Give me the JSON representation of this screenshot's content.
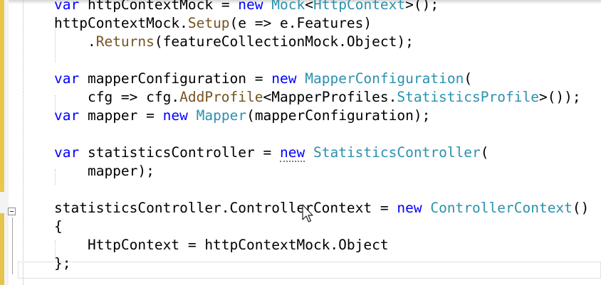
{
  "editor": {
    "lines": [
      [
        {
          "t": "var",
          "c": "kw"
        },
        {
          "t": " httpContextMock = "
        },
        {
          "t": "new",
          "c": "kw"
        },
        {
          "t": " "
        },
        {
          "t": "Mock",
          "c": "ty"
        },
        {
          "t": "<"
        },
        {
          "t": "HttpContext",
          "c": "ty"
        },
        {
          "t": ">();"
        }
      ],
      [
        {
          "t": "httpContextMock."
        },
        {
          "t": "Setup",
          "c": "me"
        },
        {
          "t": "(e => e.Features)"
        }
      ],
      [
        {
          "t": "    ."
        },
        {
          "t": "Returns",
          "c": "me"
        },
        {
          "t": "(featureCollectionMock.Object);"
        }
      ],
      [],
      [
        {
          "t": "var",
          "c": "kw"
        },
        {
          "t": " mapperConfiguration = "
        },
        {
          "t": "new",
          "c": "kw"
        },
        {
          "t": " "
        },
        {
          "t": "MapperConfiguration",
          "c": "ty"
        },
        {
          "t": "("
        }
      ],
      [
        {
          "t": "    cfg => cfg."
        },
        {
          "t": "AddProfile",
          "c": "me"
        },
        {
          "t": "<MapperProfiles."
        },
        {
          "t": "StatisticsProfile",
          "c": "ty"
        },
        {
          "t": ">());"
        }
      ],
      [
        {
          "t": "var",
          "c": "kw"
        },
        {
          "t": " mapper = "
        },
        {
          "t": "new",
          "c": "kw"
        },
        {
          "t": " "
        },
        {
          "t": "Mapper",
          "c": "ty"
        },
        {
          "t": "(mapperConfiguration);"
        }
      ],
      [],
      [
        {
          "t": "var",
          "c": "kw"
        },
        {
          "t": " statisticsController = "
        },
        {
          "t": "new",
          "c": "kw sq"
        },
        {
          "t": " "
        },
        {
          "t": "StatisticsController",
          "c": "ty"
        },
        {
          "t": "("
        }
      ],
      [
        {
          "t": "    mapper);"
        }
      ],
      [],
      [
        {
          "t": "statisticsController.ControllerContext = "
        },
        {
          "t": "new",
          "c": "kw"
        },
        {
          "t": " "
        },
        {
          "t": "ControllerContext",
          "c": "ty"
        },
        {
          "t": "()"
        }
      ],
      [
        {
          "t": "{"
        }
      ],
      [
        {
          "t": "    HttpContext = httpContextMock.Object"
        }
      ],
      [
        {
          "t": "};"
        }
      ]
    ]
  }
}
